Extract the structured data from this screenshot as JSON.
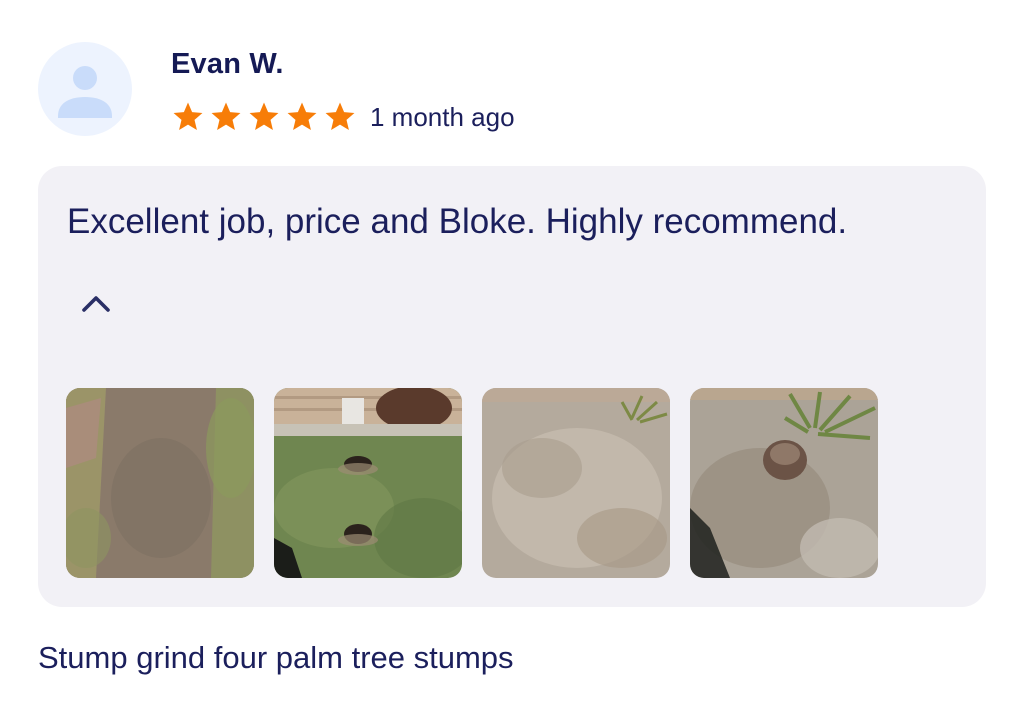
{
  "reviewer": {
    "name": "Evan W.",
    "avatar_icon": "user-placeholder-icon",
    "rating": 5,
    "rating_max": 5,
    "posted": "1 month ago"
  },
  "review": {
    "text": "Excellent job, price and Bloke. Highly recommend.",
    "collapse_icon": "chevron-up-icon",
    "photos": [
      {
        "subject": "ground-grass-patch"
      },
      {
        "subject": "lawn-with-two-stump-holes"
      },
      {
        "subject": "ground-sawdust-patch"
      },
      {
        "subject": "stump-with-sawdust-and-plant"
      }
    ]
  },
  "job": {
    "title": "Stump grind four palm tree stumps"
  },
  "colors": {
    "text": "#1b1f5c",
    "star": "#f77d08",
    "card_background": "#f2f1f6",
    "avatar_background": "#edf3fe",
    "avatar_figure": "#c9dcfa"
  }
}
